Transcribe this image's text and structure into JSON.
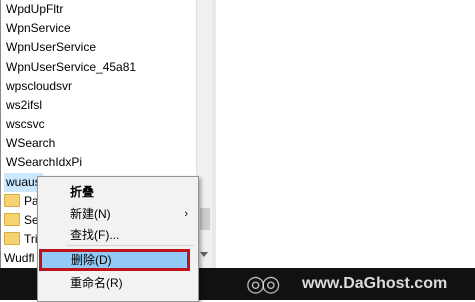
{
  "tree": {
    "items": [
      "WpdUpFltr",
      "WpnService",
      "WpnUserService",
      "WpnUserService_45a81",
      "wpscloudsvr",
      "ws2ifsl",
      "wscsvc",
      "WSearch",
      "WSearchIdxPi",
      "wuaus"
    ],
    "subfolders": [
      "Par",
      "Sec",
      "Trig"
    ],
    "last_item": "Wudfl"
  },
  "context_menu": {
    "items": [
      {
        "label": "折叠",
        "bold": true,
        "submenu": false
      },
      {
        "label": "新建(N)",
        "bold": false,
        "submenu": true
      },
      {
        "label": "查找(F)...",
        "bold": false,
        "submenu": false
      },
      {
        "label": "删除(D)",
        "bold": false,
        "submenu": false,
        "highlighted": true
      },
      {
        "label": "重命名(R)",
        "bold": false,
        "submenu": false
      }
    ],
    "submenu_arrow": "›"
  },
  "watermark": {
    "logo_glyph": "◎◎",
    "text": "www.DaGhost.com"
  },
  "colors": {
    "highlight_fill": "#91c9f7",
    "highlight_border": "#c0141a",
    "selected_bg": "#cce8ff"
  }
}
